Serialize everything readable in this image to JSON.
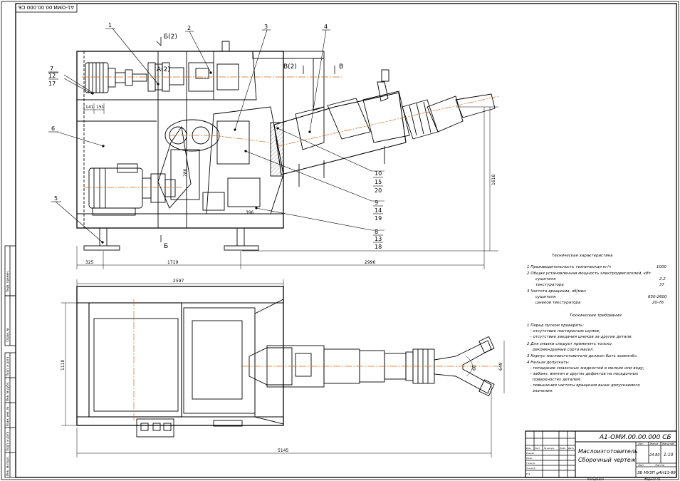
{
  "colors": {
    "paper": "#ffffff",
    "line": "#000000",
    "centerline": "#d2691e",
    "hatch": "#555555",
    "tech_text": "#000000"
  },
  "top_stamp": "А1-ОМИ.00.00.000 СБ",
  "callouts": {
    "c1": "1",
    "c2": "2",
    "c3": "3",
    "c4": "4",
    "c5": "5",
    "c6": "6",
    "c7": "7",
    "c12a": "12",
    "c17": "17",
    "c10": "10",
    "c15": "15",
    "c20": "20",
    "c9": "9",
    "c14": "14",
    "c19": "19",
    "c8": "8",
    "c13": "13",
    "c18": "18"
  },
  "section_marks": {
    "b2": "Б(2)",
    "a2": "А(2)",
    "v2": "В(2)",
    "v": "В",
    "b": "Б"
  },
  "dimensions": {
    "d141": "141",
    "d151": "151",
    "d325": "325",
    "d1719": "1719",
    "d2996": "2996",
    "d1618": "1618",
    "d2597": "2597",
    "d1110": "1110",
    "d5145": "5145",
    "d649": "649",
    "d60": "60",
    "d280": "280",
    "d396": "396"
  },
  "tech_specs": {
    "title": "Техническая характеристика",
    "l1": "1  Производительность  техническая  кг/ч",
    "l1v": "1000",
    "l2": "2  Общая  установленная  мощность  электродвигателей,  кВт",
    "l2a": "сушителя",
    "l2av": "2,2",
    "l2b": "текстуратора",
    "l2bv": "37",
    "l3": "3  Частота  вращения,  об/мин",
    "l3a": "сушителя",
    "l3av": "650-2600",
    "l3b": "шнеков  текстуратора",
    "l3bv": "20-76"
  },
  "tech_req": {
    "title": "Технические требования",
    "r1": "1  Перед  пуском  проверить:",
    "r1a": "– отсутствие  посторонних  шумов;",
    "r1b": "– отсутствие  заедания  шнеков  за  другие  детали.",
    "r2": "2  Для  смазки  следует  применять  только",
    "r2a": "рекомендуемые  сорта  масел.",
    "r3": "3  Корпус  маслоизготовителя  должен  быть  заземлён.",
    "r4": "4  Нельзя  допускать:",
    "r4a": "– попадание  смазочных  жидкостей  в  мелкие  или  воду;",
    "r4b": "– забоин,  вмятин  и  других  дефектов  на  посадочных",
    "r4c": "поверхностях  деталей;",
    "r4d": "– повышения  частоты  вращения  выше  допускаемого",
    "r4e": "значения."
  },
  "title_block": {
    "doc_code": "А1-ОМИ.00.00.000 СБ",
    "name1": "Маслоизготовитель",
    "name2": "Сборочный чертеж",
    "lit_h": "Лит.",
    "mass_h": "Масса",
    "scale_h": "Масштаб",
    "mass": "24-80",
    "scale": "1:10",
    "sheet": "Лист",
    "sheets": "Листов",
    "org": "ЗБ МУЗП gАН13-89",
    "h_izm": "Изм.",
    "h_list": "Лист",
    "h_ndok": "№ докум.",
    "h_podp": "Подп.",
    "h_data": "Дата",
    "r_razr": "Разраб.",
    "r_prov": "Пров.",
    "r_tkontr": "Т.контр.",
    "r_nkontr": "Н.контр.",
    "r_utv": "Утв.",
    "copied": "Копировал",
    "format": "Формат  А1"
  },
  "side_labels": {
    "s1": "Перв. примен.",
    "s2": "Справ. №",
    "s3": "Подп. и дата",
    "s4": "Инв. № дубл.",
    "s5": "Взам. инв. №",
    "s6": "Подп. и дата",
    "s7": "Инв. № подл."
  }
}
